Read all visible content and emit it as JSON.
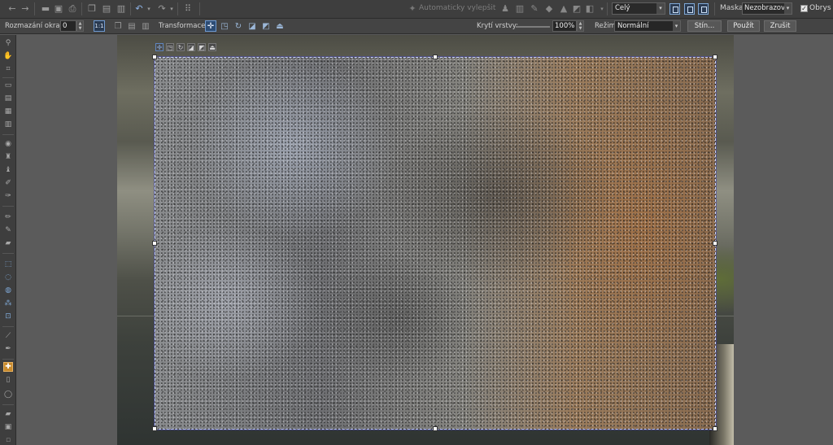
{
  "toolbar1": {
    "auto_enhance_label": "Automaticky vylepšit",
    "view_select_value": "Celý",
    "mask_label": "Maska:",
    "mask_select_value": "Nezobrazovat",
    "outline_label": "Obrys",
    "outline_checked": true,
    "icons": [
      "back-icon",
      "forward-icon",
      "open-icon",
      "save-icon",
      "print-icon",
      "copy-icon",
      "paste-icon",
      "paste-new-icon",
      "undo-icon",
      "redo-icon",
      "arrange-icon"
    ]
  },
  "toolbar2": {
    "feather_label": "Rozmazání okrajů:",
    "feather_value": "0",
    "transform_label": "Transformace:",
    "opacity_label": "Krytí vrstvy:",
    "opacity_value": "100%",
    "opacity_level": 1.0,
    "mode_label": "Režim:",
    "mode_value": "Normální",
    "shadow_button": "Stín...",
    "apply_button": "Použít",
    "cancel_button": "Zrušit"
  },
  "colors": {
    "accent": "#2d4c74",
    "active_tool": "#c88a2c",
    "background": "#5a5a5a"
  }
}
